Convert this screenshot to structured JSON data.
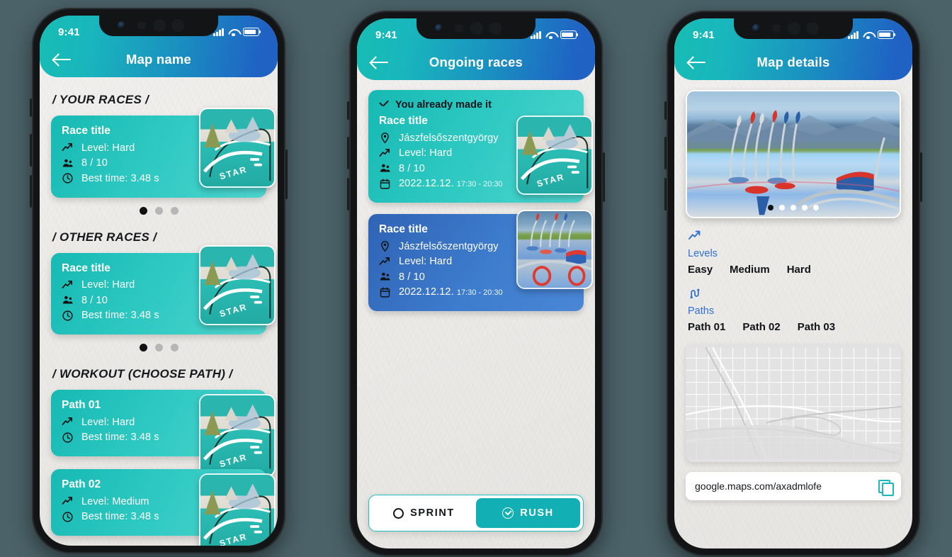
{
  "background_color": "#4a6268",
  "accent": {
    "teal": "#17b9b3",
    "blue": "#2f63b5",
    "link_blue": "#2f6fd0",
    "red_pin": "#e8342a"
  },
  "status_bar": {
    "time": "9:41",
    "signal_icon": "cellular-bars-icon",
    "wifi_icon": "wifi-icon",
    "battery_icon": "battery-icon"
  },
  "phone1": {
    "nav": {
      "back_icon": "back-arrow-icon",
      "title": "Map name"
    },
    "sections": [
      {
        "heading": "/ YOUR RACES /",
        "cards": [
          {
            "title": "Race title",
            "meta": [
              {
                "icon": "trend-up-icon",
                "text": "Level: Hard"
              },
              {
                "icon": "people-icon",
                "text": "8 / 10"
              },
              {
                "icon": "clock-icon",
                "text": "Best time: 3.48 s"
              }
            ],
            "thumb": "skatepark-teal-thumb"
          }
        ],
        "pager": {
          "count": 3,
          "active": 0
        }
      },
      {
        "heading": "/ OTHER RACES /",
        "cards": [
          {
            "title": "Race title",
            "meta": [
              {
                "icon": "trend-up-icon",
                "text": "Level: Hard"
              },
              {
                "icon": "people-icon",
                "text": "8 / 10"
              },
              {
                "icon": "clock-icon",
                "text": "Best time: 3.48 s"
              }
            ],
            "thumb": "skatepark-teal-thumb"
          }
        ],
        "pager": {
          "count": 3,
          "active": 0
        }
      },
      {
        "heading": "/ WORKOUT (CHOOSE PATH) /",
        "cards": [
          {
            "title": "Path 01",
            "meta": [
              {
                "icon": "trend-up-icon",
                "text": "Level: Hard"
              },
              {
                "icon": "clock-icon",
                "text": "Best time: 3.48 s"
              }
            ],
            "thumb": "skatepark-teal-thumb"
          },
          {
            "title": "Path 02",
            "meta": [
              {
                "icon": "trend-up-icon",
                "text": "Level: Medium"
              },
              {
                "icon": "clock-icon",
                "text": "Best time: 3.48 s"
              }
            ],
            "thumb": "skatepark-teal-thumb"
          }
        ]
      }
    ]
  },
  "phone2": {
    "nav": {
      "back_icon": "back-arrow-icon",
      "title": "Ongoing races"
    },
    "races": [
      {
        "banner": "You already made it",
        "banner_icon": "check-icon",
        "title": "Race title",
        "meta": [
          {
            "icon": "location-pin-icon",
            "text": "Jászfelsőszentgyörgy"
          },
          {
            "icon": "trend-up-icon",
            "text": "Level: Hard"
          },
          {
            "icon": "people-icon",
            "text": "8 / 10"
          },
          {
            "icon": "calendar-icon",
            "text": "2022.12.12.",
            "sub": "17:30 - 20:30"
          }
        ],
        "thumb": "skatepark-teal-thumb",
        "style": "teal"
      },
      {
        "title": "Race title",
        "meta": [
          {
            "icon": "location-pin-icon",
            "text": "Jászfelsőszentgyörgy"
          },
          {
            "icon": "trend-up-icon",
            "text": "Level: Hard"
          },
          {
            "icon": "people-icon",
            "text": "8 / 10"
          },
          {
            "icon": "calendar-icon",
            "text": "2022.12.12.",
            "sub": "17:30 - 20:30"
          }
        ],
        "thumb": "skatepark-blue-thumb",
        "style": "blue"
      }
    ],
    "segmented": {
      "sprint": {
        "label": "SPRINT",
        "icon": "circle-outline-icon",
        "active": false
      },
      "rush": {
        "label": "RUSH",
        "icon": "circle-check-icon",
        "active": true
      }
    }
  },
  "phone3": {
    "nav": {
      "back_icon": "back-arrow-icon",
      "title": "Map details"
    },
    "gallery": {
      "image": "mountain-skatepark-photo",
      "pager": {
        "count": 5,
        "active": 0
      }
    },
    "levels": {
      "icon": "trend-up-icon",
      "label": "Levels",
      "options": [
        "Easy",
        "Medium",
        "Hard"
      ]
    },
    "paths": {
      "icon": "paths-icon",
      "label": "Paths",
      "options": [
        "Path 01",
        "Path 02",
        "Path 03"
      ]
    },
    "map": {
      "pin_icon": "map-pin-icon"
    },
    "url": {
      "value": "google.maps.com/axadmlofe",
      "copy_icon": "copy-icon"
    }
  }
}
